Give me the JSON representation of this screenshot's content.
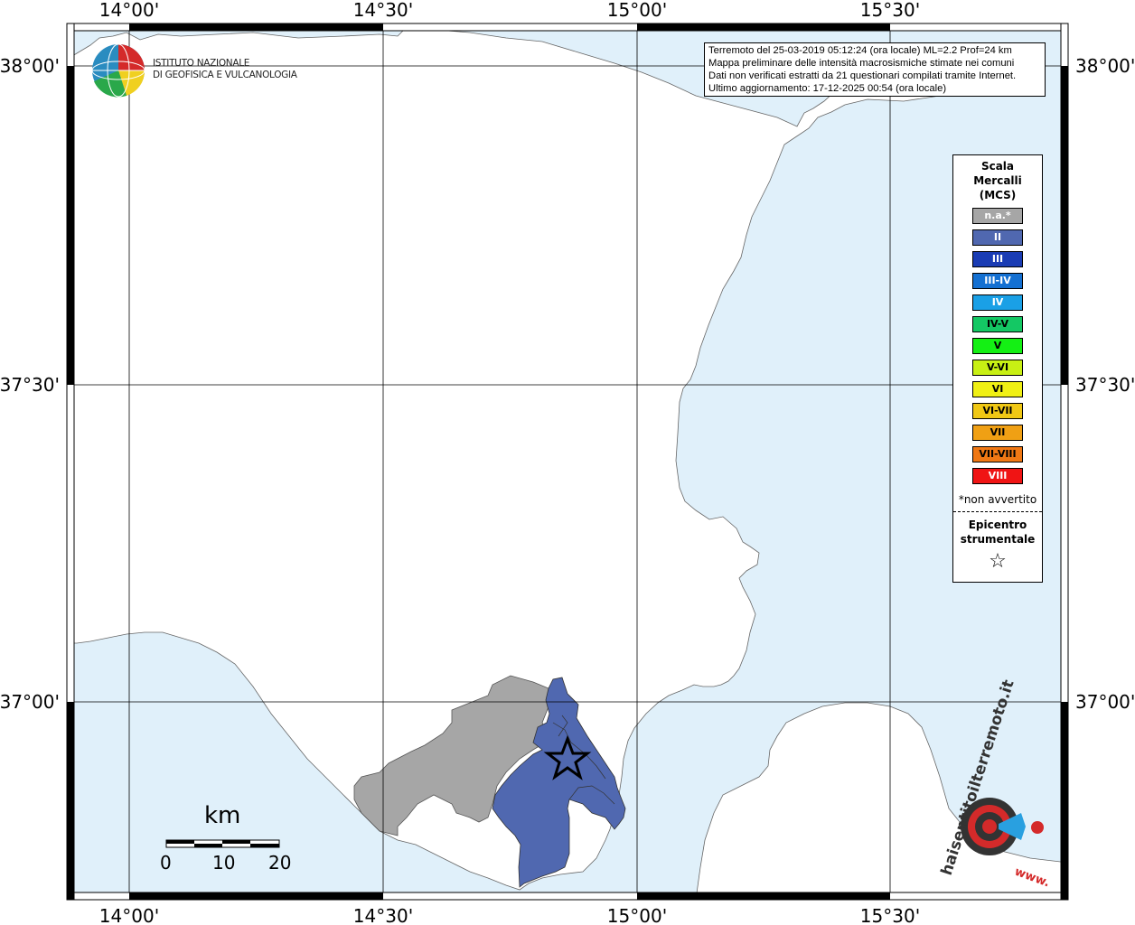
{
  "header": {
    "info_lines": [
      "Terremoto del 25-03-2019 05:12:24 (ora locale) ML=2.2 Prof=24 km",
      "Mappa preliminare delle intensità macrosismiche stimate nei comuni",
      "Dati non verificati estratti da 21 questionari compilati tramite Internet.",
      "Ultimo aggiornamento: 17-12-2025 00:54 (ora locale)"
    ]
  },
  "logo": {
    "line1": "ISTITUTO NAZIONALE",
    "line2": "DI GEOFISICA E VULCANOLOGIA",
    "icon": "ingv-globe-icon"
  },
  "axes": {
    "lon_labels": [
      "14°00'",
      "14°30'",
      "15°00'",
      "15°30'"
    ],
    "lat_labels": [
      "38°00'",
      "37°30'",
      "37°00'"
    ]
  },
  "legend": {
    "title_lines": [
      "Scala",
      "Mercalli",
      "(MCS)"
    ],
    "items": [
      {
        "label": "n.a.*",
        "color": "#a6a6a6",
        "text_color": "#ffffff"
      },
      {
        "label": "II",
        "color": "#5068b0",
        "text_color": "#ffffff"
      },
      {
        "label": "III",
        "color": "#1a3cb4",
        "text_color": "#ffffff"
      },
      {
        "label": "III-IV",
        "color": "#1470d2",
        "text_color": "#ffffff"
      },
      {
        "label": "IV",
        "color": "#1aa0e6",
        "text_color": "#ffffff"
      },
      {
        "label": "IV-V",
        "color": "#14c864",
        "text_color": "#000000"
      },
      {
        "label": "V",
        "color": "#14f014",
        "text_color": "#000000"
      },
      {
        "label": "V-VI",
        "color": "#c8f014",
        "text_color": "#000000"
      },
      {
        "label": "VI",
        "color": "#f0f014",
        "text_color": "#000000"
      },
      {
        "label": "VI-VII",
        "color": "#f0c814",
        "text_color": "#000000"
      },
      {
        "label": "VII",
        "color": "#f0a014",
        "text_color": "#000000"
      },
      {
        "label": "VII-VIII",
        "color": "#f07814",
        "text_color": "#000000"
      },
      {
        "label": "VIII",
        "color": "#f01414",
        "text_color": "#ffffff"
      }
    ],
    "note": "*non avvertito",
    "epicenter_lines": [
      "Epicentro",
      "strumentale"
    ],
    "epicenter_symbol": "☆"
  },
  "scalebar": {
    "unit": "km",
    "ticks": [
      "0",
      "10",
      "20"
    ]
  },
  "colors": {
    "sea": "#e0f0fa",
    "land": "#ffffff",
    "not_felt": "#a6a6a6",
    "intensity_II": "#5068b0"
  },
  "watermark": {
    "text": "haisentitoilterremoto.it",
    "prefix": "www."
  }
}
